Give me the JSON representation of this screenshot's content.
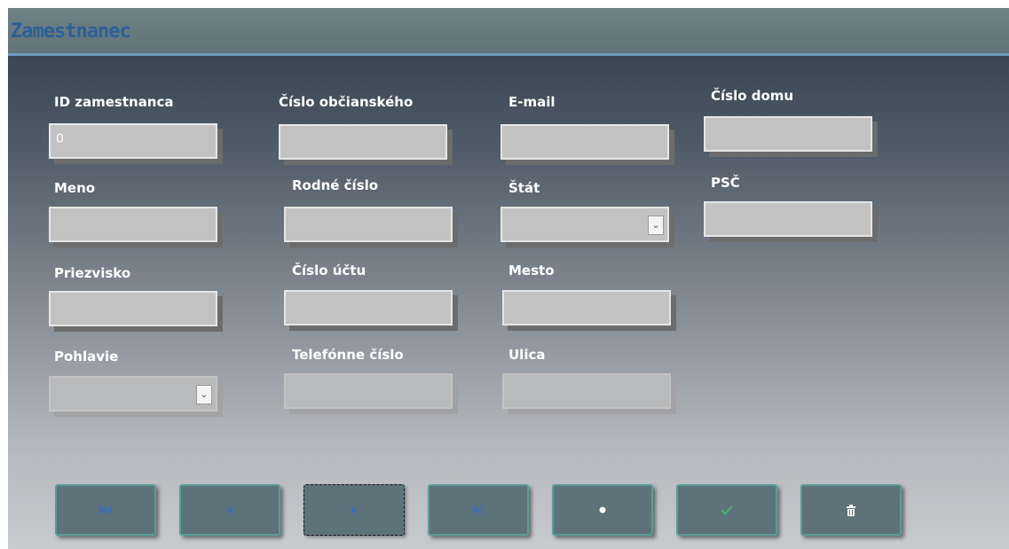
{
  "window": {
    "title": "Zamestnanec"
  },
  "labels": {
    "id": "ID zamestnanca",
    "obcianske": "Číslo občianského",
    "email": "E-mail",
    "domu": "Číslo domu",
    "meno": "Meno",
    "rodne": "Rodné číslo",
    "stat": "Štát",
    "psc": "PSČ",
    "priezvisko": "Priezvisko",
    "ucet": "Číslo účtu",
    "mesto": "Mesto",
    "pohlavie": "Pohlavie",
    "telefon": "Telefónne číslo",
    "ulica": "Ulica"
  },
  "values": {
    "id": "0",
    "obcianske": "",
    "email": "",
    "domu": "",
    "meno": "",
    "rodne": "",
    "stat": "",
    "psc": "",
    "priezvisko": "",
    "ucet": "",
    "mesto": "",
    "pohlavie": "",
    "telefon": "",
    "ulica": ""
  },
  "icons": {
    "first": "first-record-icon",
    "prev": "previous-record-icon",
    "next": "next-record-icon",
    "last": "last-record-icon",
    "new": "new-record-icon",
    "save": "checkmark-icon",
    "delete": "trash-icon"
  },
  "colors": {
    "title_text": "#2c6096",
    "titlebar": "#667a80",
    "button_face": "#5e727a",
    "button_border": "#5a9d95",
    "nav_icon": "#3f6fae",
    "check_icon": "#48b06c"
  }
}
